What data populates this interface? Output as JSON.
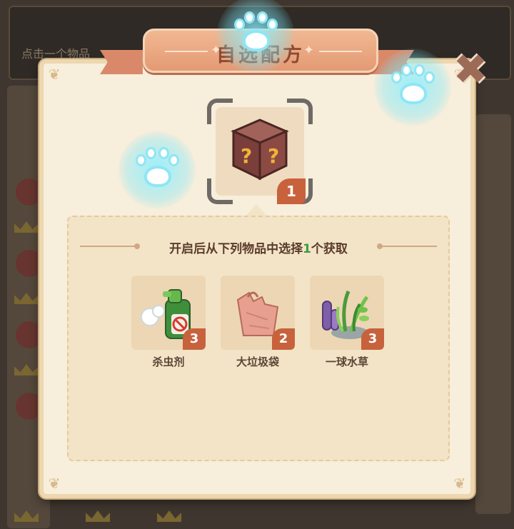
{
  "background": {
    "hint_text": "点击一个物品"
  },
  "dialog": {
    "title": "自选配方",
    "close_glyph": "✖",
    "box_count": "1",
    "instruction_prefix": "开启后从下列物品中选择",
    "instruction_count": "1",
    "instruction_suffix": "个获取",
    "items": [
      {
        "name": "杀虫剂",
        "count": "3",
        "icon": "insecticide-spray-icon"
      },
      {
        "name": "大垃圾袋",
        "count": "2",
        "icon": "garbage-bag-icon"
      },
      {
        "name": "一球水草",
        "count": "3",
        "icon": "water-plant-icon"
      }
    ]
  },
  "colors": {
    "panel": "#f7eedb",
    "ribbon": "#e49a74",
    "badge": "#c7623c",
    "highlight": "#3e9b3e",
    "paw_glow": "#8ee6f5"
  }
}
